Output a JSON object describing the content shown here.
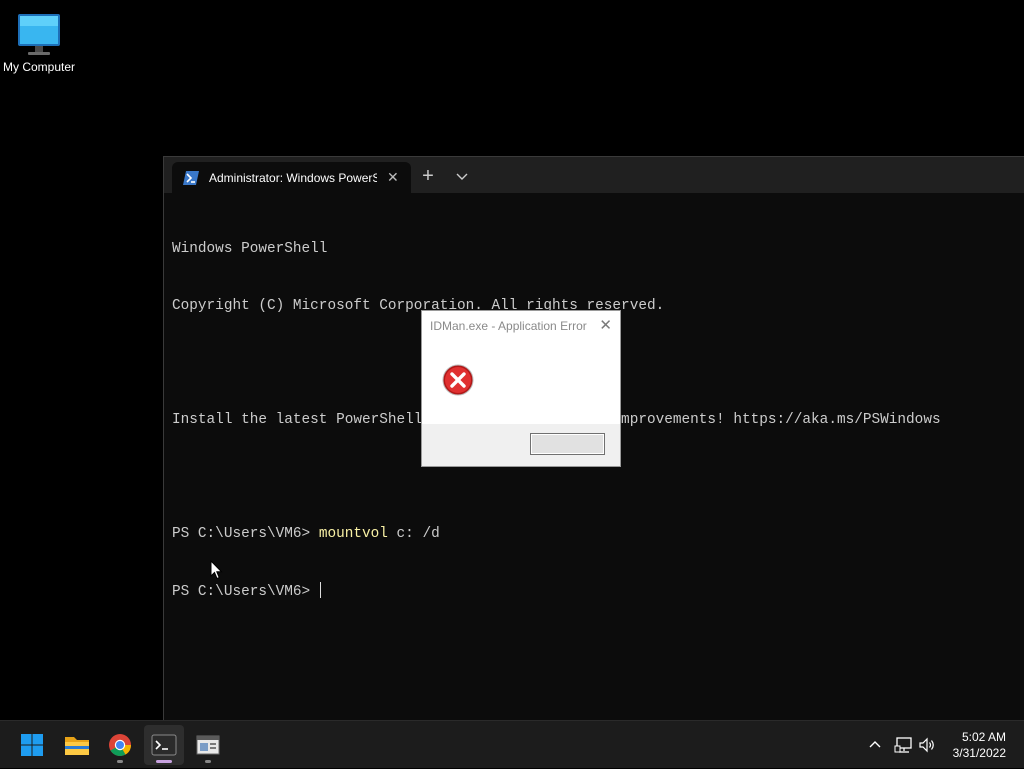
{
  "desktop": {
    "icons": [
      {
        "label": "My Computer",
        "icon": "computer-monitor-icon"
      }
    ]
  },
  "terminal": {
    "tab_title": "Administrator: Windows PowerShell",
    "tab_icon": "powershell-icon",
    "new_tab_label": "+",
    "lines": [
      "Windows PowerShell",
      "Copyright (C) Microsoft Corporation. All rights reserved.",
      "",
      "Install the latest PowerShell for new features and improvements! https://aka.ms/PSWindows",
      ""
    ],
    "prompt_1": "PS C:\\Users\\VM6> ",
    "command_1": "mountvol",
    "command_1_args": " c: /d",
    "prompt_2": "PS C:\\Users\\VM6> "
  },
  "dialog": {
    "title": "IDMan.exe - Application Error",
    "close_label": "✕",
    "icon": "error-icon",
    "ok_label": ""
  },
  "taskbar": {
    "apps": [
      "start-icon",
      "file-explorer-icon",
      "chrome-icon",
      "terminal-icon",
      "app-window-icon"
    ],
    "tray": [
      "chevron-up-icon",
      "network-icon",
      "volume-icon"
    ],
    "time": "5:02 AM",
    "date": "3/31/2022"
  },
  "colors": {
    "terminal_bg": "#0c0c0c",
    "command_yellow": "#f9f1a5",
    "taskbar_bg": "#1c1c1c",
    "error_red": "#d42020"
  }
}
